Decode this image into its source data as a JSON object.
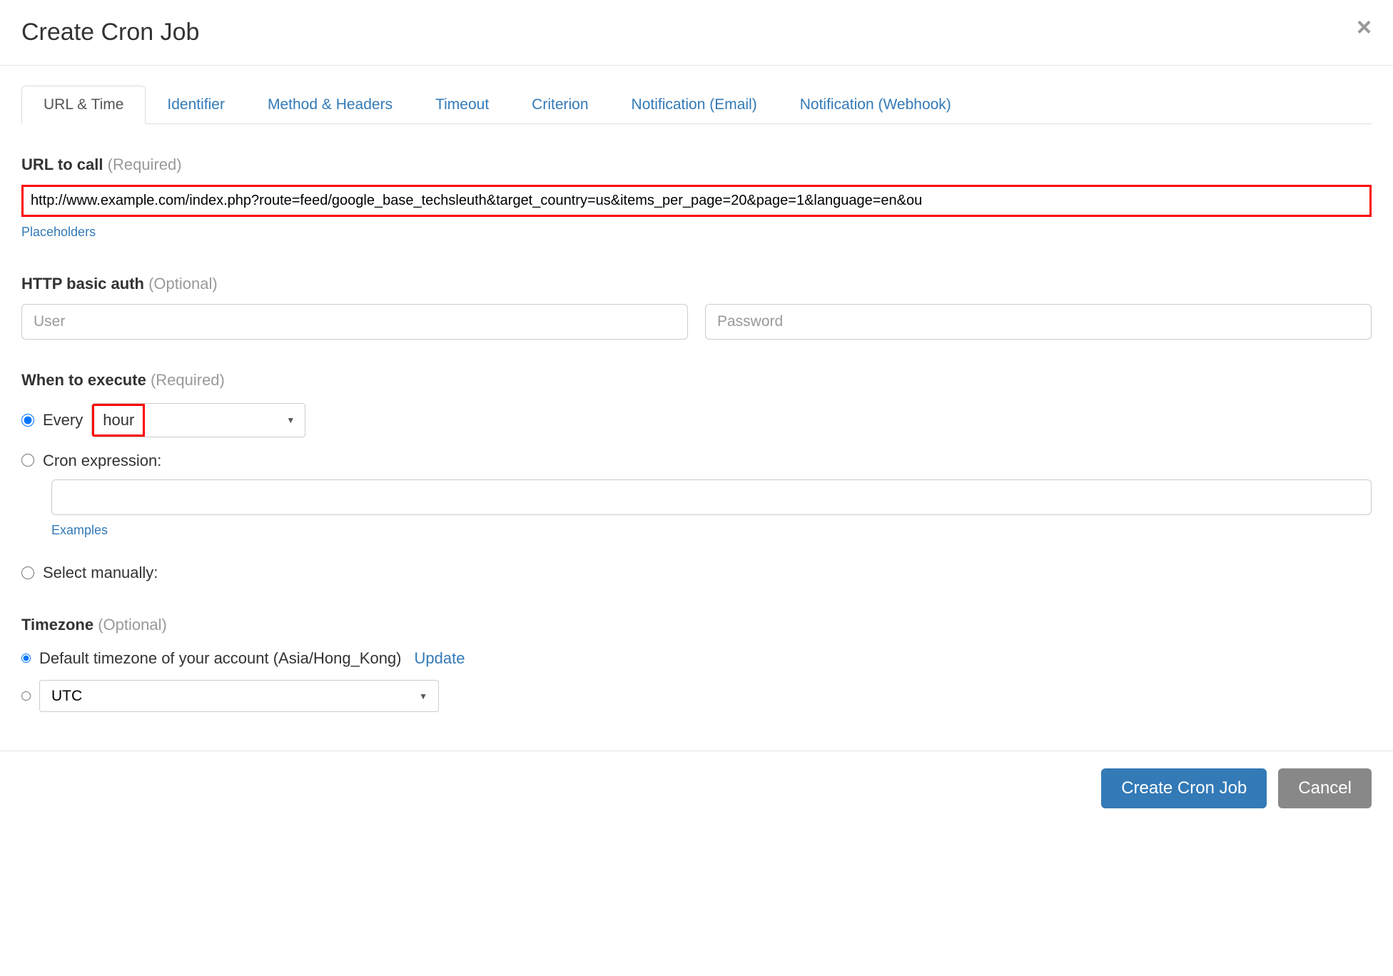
{
  "header": {
    "title": "Create Cron Job"
  },
  "tabs": [
    {
      "label": "URL & Time",
      "active": true
    },
    {
      "label": "Identifier",
      "active": false
    },
    {
      "label": "Method & Headers",
      "active": false
    },
    {
      "label": "Timeout",
      "active": false
    },
    {
      "label": "Criterion",
      "active": false
    },
    {
      "label": "Notification (Email)",
      "active": false
    },
    {
      "label": "Notification (Webhook)",
      "active": false
    }
  ],
  "url_section": {
    "label": "URL to call",
    "hint": "(Required)",
    "value": "http://www.example.com/index.php?route=feed/google_base_techsleuth&target_country=us&items_per_page=20&page=1&language=en&ou",
    "placeholders_link": "Placeholders"
  },
  "auth_section": {
    "label": "HTTP basic auth",
    "hint": "(Optional)",
    "user_placeholder": "User",
    "password_placeholder": "Password"
  },
  "execute_section": {
    "label": "When to execute",
    "hint": "(Required)",
    "every_label": "Every",
    "interval_value": "hour",
    "cron_label": "Cron expression:",
    "cron_value": "",
    "examples_link": "Examples",
    "manual_label": "Select manually:"
  },
  "timezone_section": {
    "label": "Timezone",
    "hint": "(Optional)",
    "default_label": "Default timezone of your account (Asia/Hong_Kong)",
    "update_link": "Update",
    "utc_value": "UTC"
  },
  "footer": {
    "create_label": "Create Cron Job",
    "cancel_label": "Cancel"
  }
}
